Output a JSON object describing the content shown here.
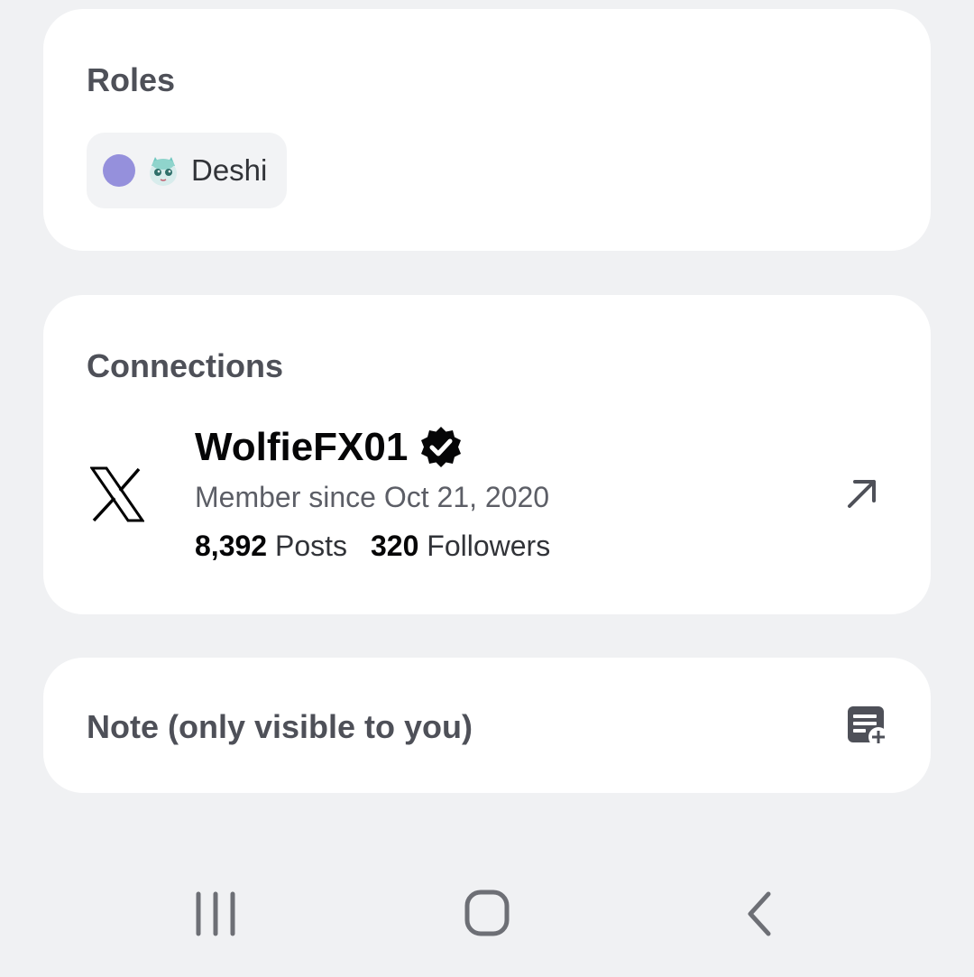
{
  "roles": {
    "title": "Roles",
    "items": [
      {
        "name": "Deshi",
        "color": "#9590dc",
        "icon": "role-emoji-icon"
      }
    ]
  },
  "connections": {
    "title": "Connections",
    "items": [
      {
        "platform": "x-logo-icon",
        "name": "WolfieFX01",
        "verified": true,
        "member_since": "Member since Oct 21, 2020",
        "posts_count": "8,392",
        "posts_label": "Posts",
        "followers_count": "320",
        "followers_label": "Followers"
      }
    ]
  },
  "note": {
    "title": "Note (only visible to you)"
  },
  "nav": {
    "recents": "recents-icon",
    "home": "home-icon",
    "back": "back-icon"
  }
}
